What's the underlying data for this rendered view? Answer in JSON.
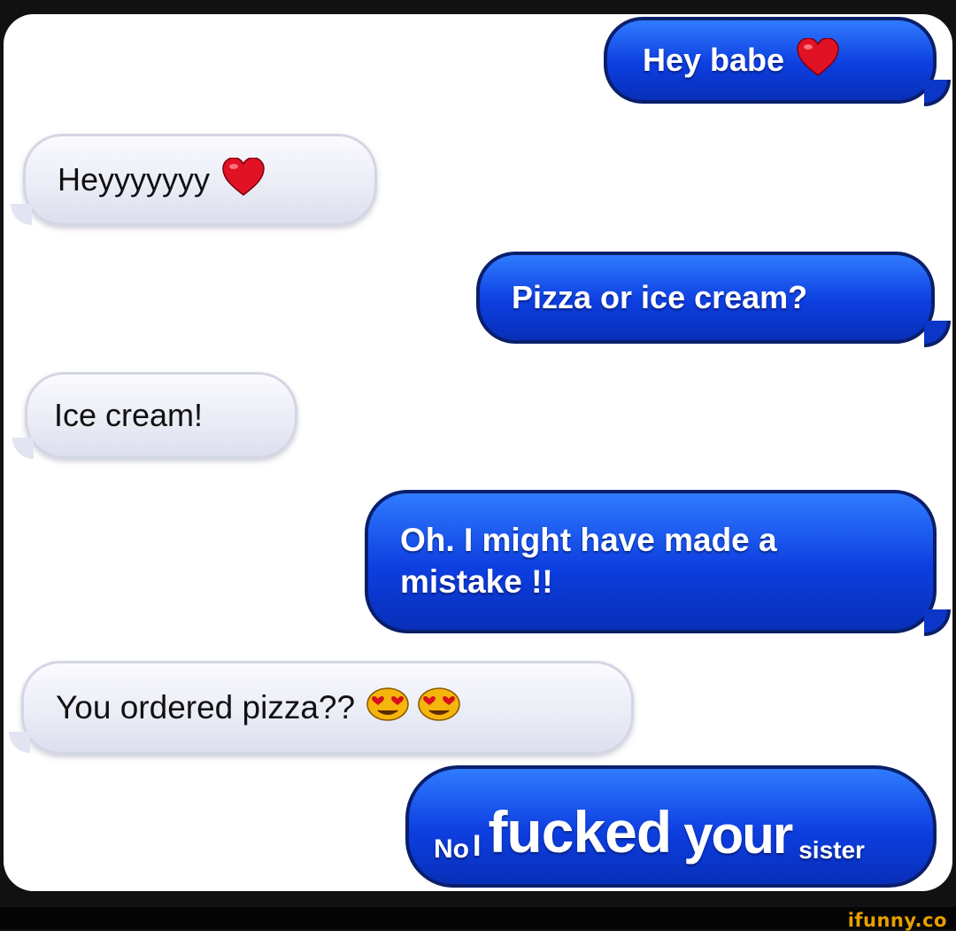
{
  "messages": [
    {
      "direction": "sent",
      "text": "Hey babe",
      "emoji": "heart-emoji"
    },
    {
      "direction": "received",
      "text": "Heyyyyyyy",
      "emoji": "heart-emoji"
    },
    {
      "direction": "sent",
      "text": "Pizza or ice cream?"
    },
    {
      "direction": "received",
      "text": "Ice cream!"
    },
    {
      "direction": "sent",
      "line1": "Oh. I might have made a",
      "line2": "mistake !!"
    },
    {
      "direction": "received",
      "text": "You ordered pizza??",
      "emoji": "heart-eyes-emoji"
    },
    {
      "direction": "sent",
      "words": [
        "No",
        "I",
        "fucked",
        "your",
        "sister"
      ]
    }
  ],
  "watermark": "ifunny.co",
  "colors": {
    "sent_bubble": "#0d3ee0",
    "received_bubble": "#e9ebf5",
    "heart": "#e01224",
    "emoji_face": "#f5b50c",
    "watermark": "#e8a000"
  }
}
